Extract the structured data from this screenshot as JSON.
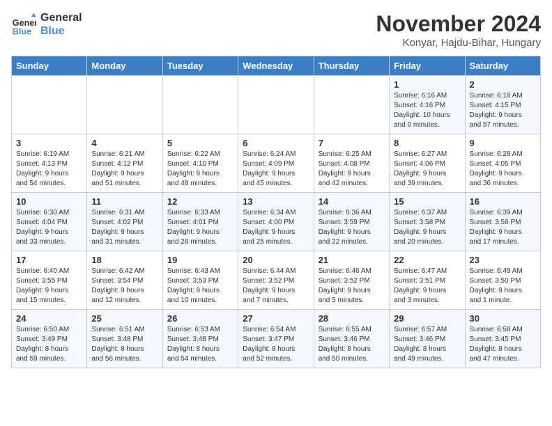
{
  "logo": {
    "line1": "General",
    "line2": "Blue"
  },
  "title": "November 2024",
  "subtitle": "Konyar, Hajdu-Bihar, Hungary",
  "days_of_week": [
    "Sunday",
    "Monday",
    "Tuesday",
    "Wednesday",
    "Thursday",
    "Friday",
    "Saturday"
  ],
  "weeks": [
    [
      {
        "num": "",
        "info": ""
      },
      {
        "num": "",
        "info": ""
      },
      {
        "num": "",
        "info": ""
      },
      {
        "num": "",
        "info": ""
      },
      {
        "num": "",
        "info": ""
      },
      {
        "num": "1",
        "info": "Sunrise: 6:16 AM\nSunset: 4:16 PM\nDaylight: 10 hours\nand 0 minutes."
      },
      {
        "num": "2",
        "info": "Sunrise: 6:18 AM\nSunset: 4:15 PM\nDaylight: 9 hours\nand 57 minutes."
      }
    ],
    [
      {
        "num": "3",
        "info": "Sunrise: 6:19 AM\nSunset: 4:13 PM\nDaylight: 9 hours\nand 54 minutes."
      },
      {
        "num": "4",
        "info": "Sunrise: 6:21 AM\nSunset: 4:12 PM\nDaylight: 9 hours\nand 51 minutes."
      },
      {
        "num": "5",
        "info": "Sunrise: 6:22 AM\nSunset: 4:10 PM\nDaylight: 9 hours\nand 48 minutes."
      },
      {
        "num": "6",
        "info": "Sunrise: 6:24 AM\nSunset: 4:09 PM\nDaylight: 9 hours\nand 45 minutes."
      },
      {
        "num": "7",
        "info": "Sunrise: 6:25 AM\nSunset: 4:08 PM\nDaylight: 9 hours\nand 42 minutes."
      },
      {
        "num": "8",
        "info": "Sunrise: 6:27 AM\nSunset: 4:06 PM\nDaylight: 9 hours\nand 39 minutes."
      },
      {
        "num": "9",
        "info": "Sunrise: 6:28 AM\nSunset: 4:05 PM\nDaylight: 9 hours\nand 36 minutes."
      }
    ],
    [
      {
        "num": "10",
        "info": "Sunrise: 6:30 AM\nSunset: 4:04 PM\nDaylight: 9 hours\nand 33 minutes."
      },
      {
        "num": "11",
        "info": "Sunrise: 6:31 AM\nSunset: 4:02 PM\nDaylight: 9 hours\nand 31 minutes."
      },
      {
        "num": "12",
        "info": "Sunrise: 6:33 AM\nSunset: 4:01 PM\nDaylight: 9 hours\nand 28 minutes."
      },
      {
        "num": "13",
        "info": "Sunrise: 6:34 AM\nSunset: 4:00 PM\nDaylight: 9 hours\nand 25 minutes."
      },
      {
        "num": "14",
        "info": "Sunrise: 6:36 AM\nSunset: 3:59 PM\nDaylight: 9 hours\nand 22 minutes."
      },
      {
        "num": "15",
        "info": "Sunrise: 6:37 AM\nSunset: 3:58 PM\nDaylight: 9 hours\nand 20 minutes."
      },
      {
        "num": "16",
        "info": "Sunrise: 6:39 AM\nSunset: 3:56 PM\nDaylight: 9 hours\nand 17 minutes."
      }
    ],
    [
      {
        "num": "17",
        "info": "Sunrise: 6:40 AM\nSunset: 3:55 PM\nDaylight: 9 hours\nand 15 minutes."
      },
      {
        "num": "18",
        "info": "Sunrise: 6:42 AM\nSunset: 3:54 PM\nDaylight: 9 hours\nand 12 minutes."
      },
      {
        "num": "19",
        "info": "Sunrise: 6:43 AM\nSunset: 3:53 PM\nDaylight: 9 hours\nand 10 minutes."
      },
      {
        "num": "20",
        "info": "Sunrise: 6:44 AM\nSunset: 3:52 PM\nDaylight: 9 hours\nand 7 minutes."
      },
      {
        "num": "21",
        "info": "Sunrise: 6:46 AM\nSunset: 3:52 PM\nDaylight: 9 hours\nand 5 minutes."
      },
      {
        "num": "22",
        "info": "Sunrise: 6:47 AM\nSunset: 3:51 PM\nDaylight: 9 hours\nand 3 minutes."
      },
      {
        "num": "23",
        "info": "Sunrise: 6:49 AM\nSunset: 3:50 PM\nDaylight: 9 hours\nand 1 minute."
      }
    ],
    [
      {
        "num": "24",
        "info": "Sunrise: 6:50 AM\nSunset: 3:49 PM\nDaylight: 8 hours\nand 59 minutes."
      },
      {
        "num": "25",
        "info": "Sunrise: 6:51 AM\nSunset: 3:48 PM\nDaylight: 8 hours\nand 56 minutes."
      },
      {
        "num": "26",
        "info": "Sunrise: 6:53 AM\nSunset: 3:48 PM\nDaylight: 8 hours\nand 54 minutes."
      },
      {
        "num": "27",
        "info": "Sunrise: 6:54 AM\nSunset: 3:47 PM\nDaylight: 8 hours\nand 52 minutes."
      },
      {
        "num": "28",
        "info": "Sunrise: 6:55 AM\nSunset: 3:46 PM\nDaylight: 8 hours\nand 50 minutes."
      },
      {
        "num": "29",
        "info": "Sunrise: 6:57 AM\nSunset: 3:46 PM\nDaylight: 8 hours\nand 49 minutes."
      },
      {
        "num": "30",
        "info": "Sunrise: 6:58 AM\nSunset: 3:45 PM\nDaylight: 8 hours\nand 47 minutes."
      }
    ]
  ]
}
